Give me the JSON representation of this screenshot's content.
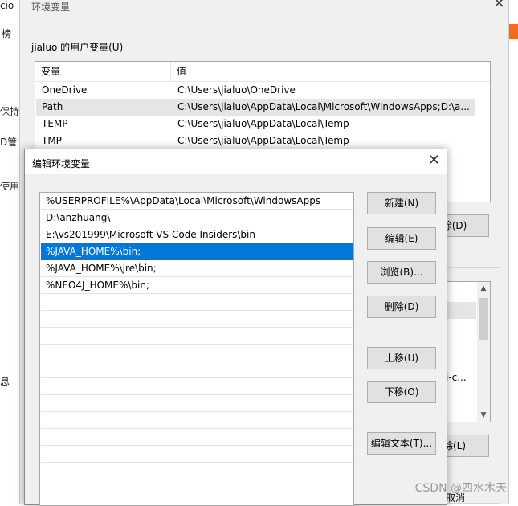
{
  "background_app": {
    "texts": [
      "cio",
      "榜",
      "保持",
      "D管",
      "使用",
      "息"
    ]
  },
  "outer_window": {
    "title": "环境变量",
    "close_glyph": "✕",
    "user_vars_group_title": "jialuo 的用户变量(U)",
    "columns": [
      "变量",
      "值"
    ],
    "rows": [
      {
        "name": "OneDrive",
        "value": "C:\\Users\\jialuo\\OneDrive"
      },
      {
        "name": "Path",
        "value": "C:\\Users\\jialuo\\AppData\\Local\\Microsoft\\WindowsApps;D:\\a..."
      },
      {
        "name": "TEMP",
        "value": "C:\\Users\\jialuo\\AppData\\Local\\Temp"
      },
      {
        "name": "TMP",
        "value": "C:\\Users\\jialuo\\AppData\\Local\\Temp"
      }
    ],
    "delete_user_label": "除(D)",
    "delete_system_label": "除(L)",
    "system_list_fragment": "i-c...",
    "cancel_fragment": "取消"
  },
  "edit_dialog": {
    "title": "编辑环境变量",
    "close_glyph": "✕",
    "entries": [
      "%USERPROFILE%\\AppData\\Local\\Microsoft\\WindowsApps",
      "D:\\anzhuang\\",
      "E:\\vs201999\\Microsoft VS Code Insiders\\bin",
      "%JAVA_HOME%\\bin;",
      "%JAVA_HOME%\\jre\\bin;",
      "%NEO4J_HOME%\\bin;"
    ],
    "selected_index": 3,
    "buttons": {
      "new": "新建(N)",
      "edit": "编辑(E)",
      "browse": "浏览(B)...",
      "delete": "删除(D)",
      "move_up": "上移(U)",
      "move_down": "下移(O)",
      "edit_text": "编辑文本(T)..."
    }
  },
  "watermark": "CSDN @四水木天",
  "colors": {
    "selection": "#0078d7",
    "dialog_bg": "#f0f0f0"
  },
  "icons": [
    "close-icon",
    "scroll-up-icon",
    "scroll-down-icon"
  ]
}
